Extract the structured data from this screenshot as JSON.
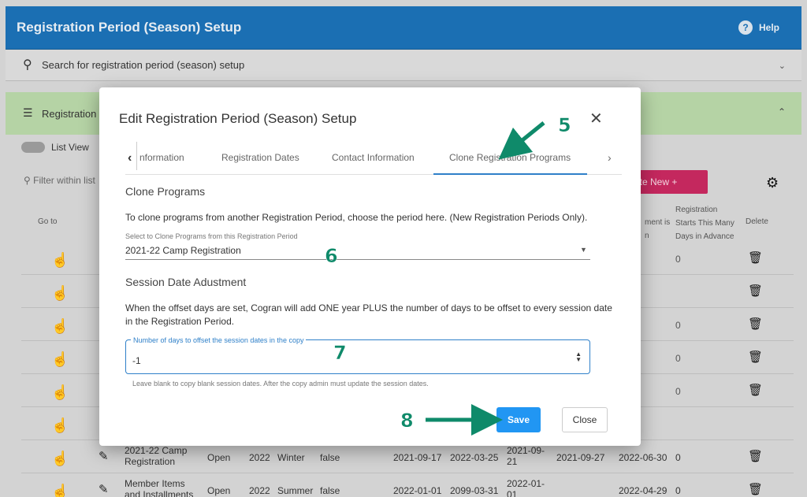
{
  "app": {
    "title": "Registration Period (Season) Setup",
    "help_label": "Help",
    "search_placeholder": "Search for registration period (season) setup",
    "section_label": "Registration",
    "list_view_label": "List View",
    "filter_placeholder": "Filter within list",
    "create_new_label": "ate New",
    "columns": {
      "go_to": "Go to",
      "assignment": "ment is\nn",
      "starts": "Registration\nStarts This Many\nDays in Advance",
      "delete": "Delete"
    },
    "rows": [
      {
        "days": "0"
      },
      {
        "days": ""
      },
      {
        "days": "0"
      },
      {
        "days": "0"
      },
      {
        "days": "0"
      },
      {
        "days": ""
      },
      {
        "name": "2021-22 Camp\nRegistration",
        "status": "Open",
        "year": "2022",
        "season": "Winter",
        "flag": "false",
        "d1": "2021-09-17",
        "d2": "2022-03-25",
        "d3": "2021-09-\n21",
        "d4": "2021-09-27",
        "d5": "2022-06-30",
        "days": "0"
      },
      {
        "name": "Member Items\nand Installments",
        "status": "Open",
        "year": "2022",
        "season": "Summer",
        "flag": "false",
        "d1": "2022-01-01",
        "d2": "2099-03-31",
        "d3": "2022-01-\n01",
        "d4": "",
        "d5": "2022-04-29",
        "days": "0"
      }
    ]
  },
  "dialog": {
    "title": "Edit Registration Period (Season) Setup",
    "tabs": [
      "nformation",
      "Registration Dates",
      "Contact Information",
      "Clone Registration Programs"
    ],
    "active_tab": "Clone Registration Programs",
    "clone_heading": "Clone Programs",
    "clone_text": "To clone programs from another Registration Period, choose the period here. (New Registration Periods Only).",
    "select_label": "Select to Clone Programs from this Registration Period",
    "select_value": "2021-22 Camp Registration",
    "adjust_heading": "Session Date Adustment",
    "adjust_text": "When the offset days are set, Cogran will add ONE year PLUS the number of days to be offset to every session date in the Registration Period.",
    "offset_label": "Number of days to offset the session dates in the copy",
    "offset_value": "-1",
    "helper_text": "Leave blank to copy blank session dates. After the copy admin must update the session dates.",
    "save_label": "Save",
    "close_label": "Close"
  },
  "annotations": {
    "step5": "5",
    "step6": "6",
    "step7": "7",
    "step8": "8"
  },
  "colors": {
    "appbar": "#1b6fb3",
    "accent": "#2196f3",
    "annotation": "#0f8a6a",
    "create": "#c4285e"
  }
}
